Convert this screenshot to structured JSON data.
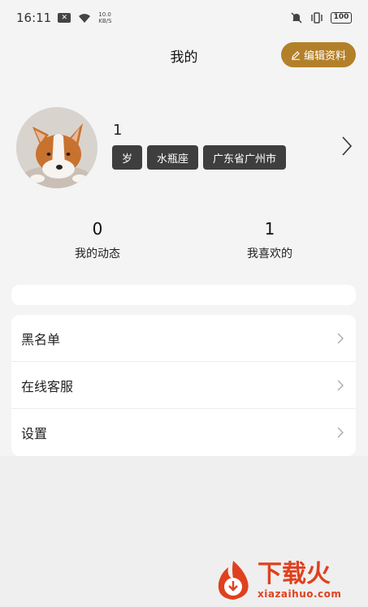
{
  "status_bar": {
    "time": "16:11",
    "net_speed_value": "10.0",
    "net_speed_unit": "KB/S",
    "battery": "100",
    "icons": [
      "notification-icon",
      "wifi-icon",
      "mute-icon",
      "vibrate-icon",
      "battery-icon"
    ]
  },
  "header": {
    "title": "我的",
    "edit_button_label": "编辑资料",
    "edit_icon": "pencil-icon"
  },
  "profile": {
    "name": "1",
    "tags": [
      "岁",
      "水瓶座",
      "广东省广州市"
    ],
    "avatar": "corgi-avatar"
  },
  "stats": {
    "posts": {
      "value": "0",
      "label": "我的动态"
    },
    "likes": {
      "value": "1",
      "label": "我喜欢的"
    }
  },
  "menu": {
    "items": [
      {
        "label": "黑名单"
      },
      {
        "label": "在线客服"
      },
      {
        "label": "设置"
      }
    ]
  },
  "watermark": {
    "title": "下载火",
    "url": "xiazaihuo.com"
  },
  "colors": {
    "accent": "#b3802a",
    "tag_bg": "#3e3e3e",
    "page_bg": "#f4f4f5",
    "watermark": "#e0401e"
  }
}
